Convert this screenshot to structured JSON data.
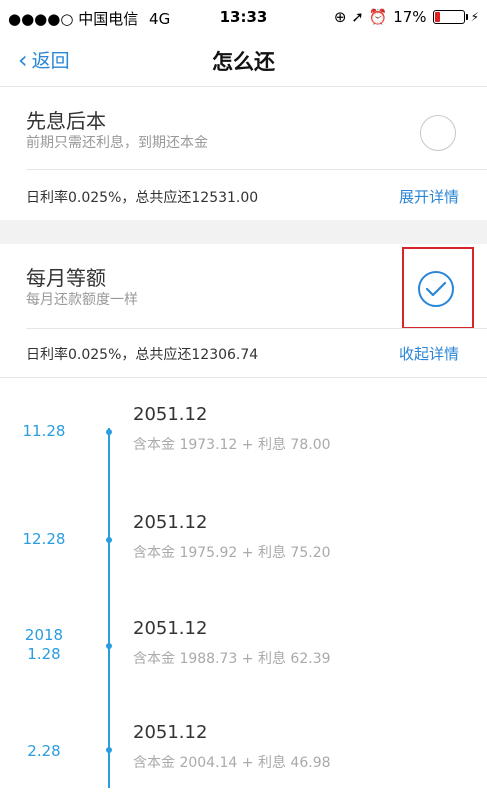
{
  "status_bar": {
    "signal": "●●●●○",
    "carrier": "中国电信",
    "network": "4G",
    "time": "13:33",
    "right_icons": "⊕ ➚ ⏰",
    "battery_text": "17%",
    "battery_level": 0.17,
    "charging": "⚡"
  },
  "nav": {
    "back_label": "返回",
    "title": "怎么还"
  },
  "plans": [
    {
      "name": "先息后本",
      "desc": "前期只需还利息，到期还本金",
      "summary": "日利率0.025%，总共应还12531.00",
      "toggle_label": "展开详情",
      "selected": false
    },
    {
      "name": "每月等额",
      "desc": "每月还款额度一样",
      "summary": "日利率0.025%，总共应还12306.74",
      "toggle_label": "收起详情",
      "selected": true
    }
  ],
  "schedule": [
    {
      "year": "",
      "date": "11.28",
      "amount": "2051.12",
      "detail": "含本金 1973.12 + 利息 78.00"
    },
    {
      "year": "",
      "date": "12.28",
      "amount": "2051.12",
      "detail": "含本金 1975.92 + 利息 75.20"
    },
    {
      "year": "2018",
      "date": "1.28",
      "amount": "2051.12",
      "detail": "含本金 1988.73 + 利息 62.39"
    },
    {
      "year": "",
      "date": "2.28",
      "amount": "2051.12",
      "detail": "含本金 2004.14 + 利息 46.98"
    }
  ],
  "colors": {
    "accent": "#2a86d6",
    "timeline": "#2a9de0",
    "highlight_box": "#d9242a"
  }
}
